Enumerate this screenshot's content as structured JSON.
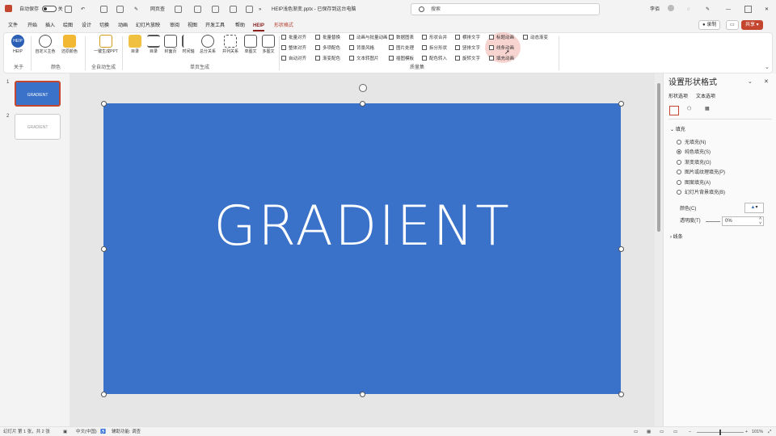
{
  "titlebar": {
    "autosave_label": "自动保存",
    "autosave_state": "关",
    "quick_access_label": "网页查",
    "doc_title": "HEIP浅色渐变.pptx - 已保存到这台电脑",
    "search_placeholder": "搜索",
    "user_name": "李佰"
  },
  "menu": {
    "tabs": [
      "文件",
      "开始",
      "插入",
      "绘图",
      "设计",
      "切换",
      "动画",
      "幻灯片放映",
      "审阅",
      "视图",
      "开发工具",
      "帮助",
      "HEIP",
      "形状格式"
    ],
    "active_tab": "HEIP",
    "record_btn": "录制",
    "share_btn": "共享"
  },
  "ribbon": {
    "big_buttons": [
      {
        "label": "HEIP",
        "color": "#2a5fb5"
      },
      {
        "label": "自定义主色"
      },
      {
        "label": "还原颜色"
      },
      {
        "label": "一键生成PPT"
      },
      {
        "label": "目录"
      },
      {
        "label": "目录"
      },
      {
        "label": "封面页"
      },
      {
        "label": "时间轴"
      },
      {
        "label": "总分关系"
      },
      {
        "label": "并列关系"
      },
      {
        "label": "单图文"
      },
      {
        "label": "多图文"
      }
    ],
    "group_labels": [
      "关于",
      "颜色",
      "全自动生成",
      "单页生成",
      "质量集"
    ],
    "checks": [
      [
        "批量对齐",
        "批量替换",
        "动画与批量动画",
        "数据图表",
        "形状合并",
        "横排文字",
        "标题动画",
        "动态渐变"
      ],
      [
        "整体对齐",
        "多项配色",
        "背景风格",
        "图片处理",
        "拆分形状",
        "竖排文字",
        "线条动画"
      ],
      [
        "自动对齐",
        "渐变配色",
        "文本转图片",
        "插图模板",
        "配色转入",
        "旋转文字",
        "填充动画"
      ]
    ]
  },
  "thumbnails": [
    {
      "num": "1",
      "label": "GRADIENT"
    },
    {
      "num": "2",
      "label": "GRADIENT"
    }
  ],
  "slide": {
    "text": "GRADIENT",
    "fill_color": "#3a71c9"
  },
  "format_pane": {
    "title": "设置形状格式",
    "tabs": [
      "形状选项",
      "文本选项"
    ],
    "fill_section": "填充",
    "fill_options": [
      "无填充(N)",
      "纯色填充(S)",
      "渐变填充(G)",
      "图片或纹理填充(P)",
      "图案填充(A)",
      "幻灯片背景填充(B)"
    ],
    "selected_fill": "纯色填充(S)",
    "color_label": "颜色(C)",
    "transparency_label": "透明度(T)",
    "transparency_value": "0%",
    "line_section": "线条"
  },
  "statusbar": {
    "slide_info": "幻灯片 第 1 张，共 2 张",
    "language": "中文(中国)",
    "accessibility": "辅助功能: 调查",
    "zoom": "101%"
  }
}
